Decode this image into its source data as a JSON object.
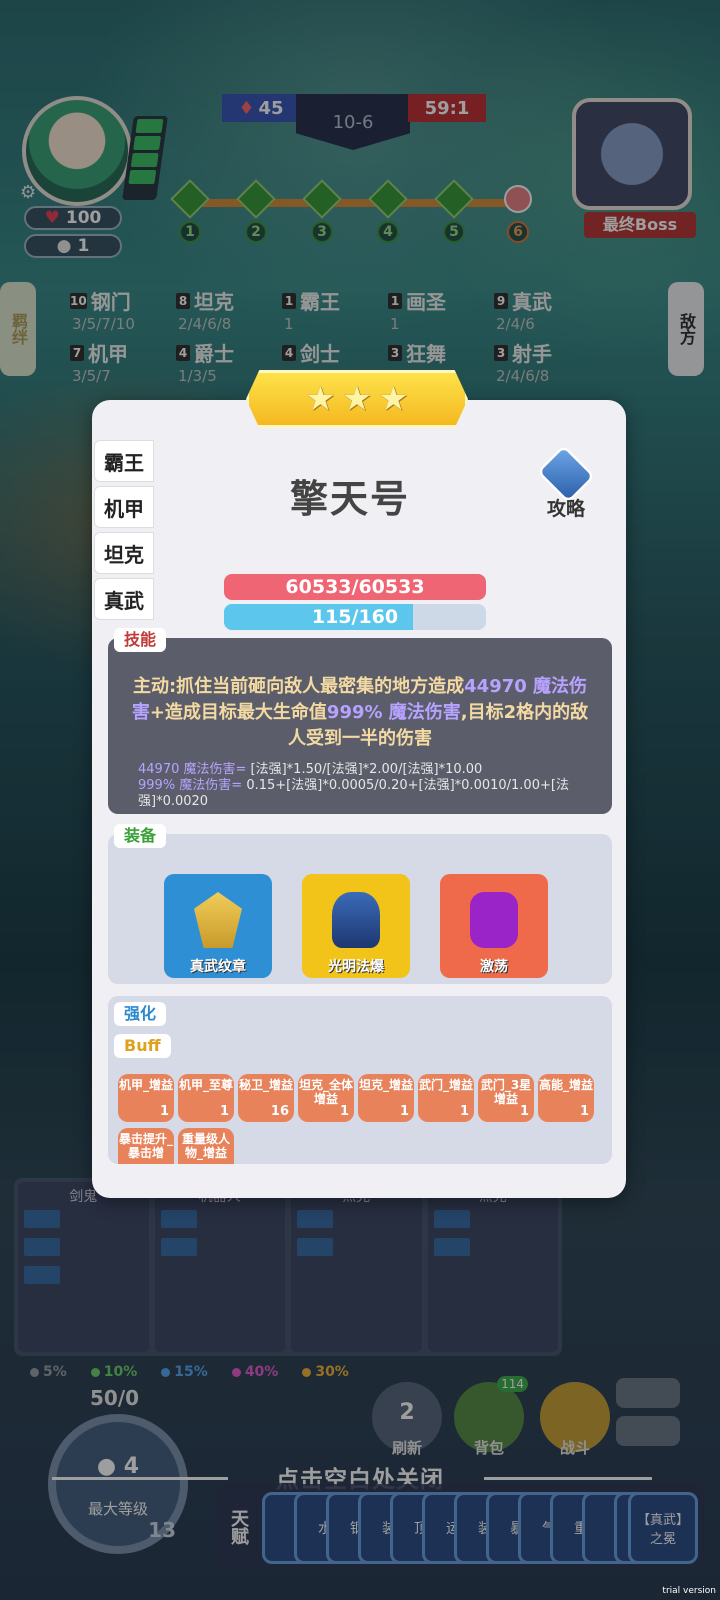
{
  "hud": {
    "player_hp": "100",
    "player_coins": "1",
    "score_left": "45",
    "round": "10-6",
    "score_right": "59:1",
    "boss_label": "最终Boss",
    "stages": [
      "1",
      "2",
      "3",
      "4",
      "5",
      "6"
    ]
  },
  "side_tabs": {
    "left": "羁绊",
    "right": "敌方"
  },
  "synergies": [
    {
      "count": "10",
      "name": "钢门",
      "tiers": "3/5/7/10"
    },
    {
      "count": "8",
      "name": "坦克",
      "tiers": "2/4/6/8"
    },
    {
      "count": "1",
      "name": "霸王",
      "tiers": "1"
    },
    {
      "count": "1",
      "name": "画圣",
      "tiers": "1"
    },
    {
      "count": "9",
      "name": "真武",
      "tiers": "2/4/6"
    },
    {
      "count": "7",
      "name": "机甲",
      "tiers": "3/5/7"
    },
    {
      "count": "4",
      "name": "爵士",
      "tiers": "1/3/5"
    },
    {
      "count": "4",
      "name": "剑士",
      "tiers": "2/4"
    },
    {
      "count": "3",
      "name": "狂舞",
      "tiers": ""
    },
    {
      "count": "3",
      "name": "射手",
      "tiers": "2/4/6/8"
    }
  ],
  "modal": {
    "unit_tabs": [
      "霸王",
      "机甲",
      "坦克",
      "真武"
    ],
    "unit_name": "擎天号",
    "guide_label": "攻略",
    "hp": {
      "text": "60533/60533",
      "fraction": 1.0
    },
    "mp": {
      "text": "115/160",
      "fraction": 0.72
    },
    "skill_tag": "技能",
    "skill_text_a": "主动:抓住当前砸向敌人最密集的地方造成",
    "skill_value_a": "44970 魔法伤害",
    "skill_text_b": "+造成目标最大生命值",
    "skill_value_b": "999% 魔法伤害",
    "skill_text_c": ",目标2格内的敌人受到一半的伤害",
    "formula_a_label": "44970 魔法伤害=",
    "formula_a": " [法强]*1.50/[法强]*2.00/[法强]*10.00",
    "formula_b_label": "999% 魔法伤害=",
    "formula_b": " 0.15+[法强]*0.0005/0.20+[法强]*0.0010/1.00+[法强]*0.0020",
    "equip_tag": "装备",
    "equipment": [
      {
        "name": "真武纹章",
        "color": "#2e8fd4"
      },
      {
        "name": "光明法爆",
        "color": "#f2c318"
      },
      {
        "name": "激荡",
        "color": "#ef6a4a"
      }
    ],
    "enhance_tag": "强化",
    "buff_tag": "Buff",
    "buffs": [
      {
        "label": "机甲_增益",
        "count": "1"
      },
      {
        "label": "机甲_至尊",
        "count": "1"
      },
      {
        "label": "秘卫_增益",
        "count": "16"
      },
      {
        "label": "坦克_全体增益",
        "count": "1"
      },
      {
        "label": "坦克_增益",
        "count": "1"
      },
      {
        "label": "武门_增益",
        "count": "1"
      },
      {
        "label": "武门_3星增益",
        "count": "1"
      },
      {
        "label": "高能_增益",
        "count": "1"
      },
      {
        "label": "暴击提升_暴击增",
        "count": ""
      },
      {
        "label": "重量级人物_增益",
        "count": ""
      }
    ]
  },
  "bench": [
    "剑鬼",
    "机器人",
    "杰克",
    "杰克"
  ],
  "odds": [
    {
      "pct": "5%",
      "color": "#9aa0a8"
    },
    {
      "pct": "10%",
      "color": "#6fd06f"
    },
    {
      "pct": "15%",
      "color": "#5aa8f0"
    },
    {
      "pct": "40%",
      "color": "#e45fd0"
    },
    {
      "pct": "30%",
      "color": "#f2b63c"
    }
  ],
  "gold": "50/0",
  "level": {
    "coin": "4",
    "label": "最大等级",
    "lv": "13"
  },
  "buttons": {
    "refresh": "刷新",
    "refresh_cost": "2",
    "bag": "背包",
    "bag_count": "114",
    "battle": "战斗"
  },
  "close_hint": "点击空白处关闭",
  "talent_label": "天赋",
  "talents": [
    "【",
    "水",
    "钢",
    "装",
    "顶",
    "运",
    "装",
    "暴",
    "气",
    "重",
    "【",
    "金",
    "【真武】之冕"
  ],
  "watermark": "trial version"
}
